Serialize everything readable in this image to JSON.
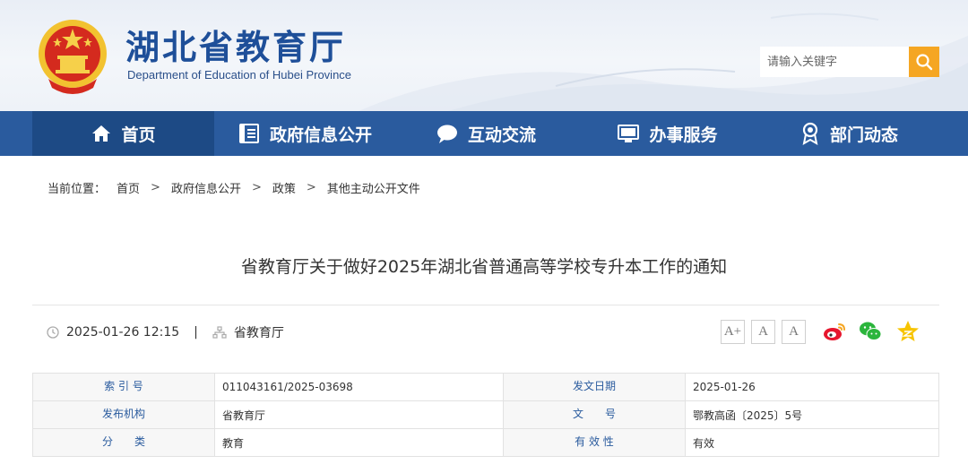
{
  "header": {
    "site_title": "湖北省教育厅",
    "site_subtitle": "Department of Education of Hubei Province",
    "search_placeholder": "请输入关键字",
    "accent_color": "#2a5b9e"
  },
  "nav": {
    "items": [
      {
        "label": "首页",
        "icon": "home-icon"
      },
      {
        "label": "政府信息公开",
        "icon": "document-icon"
      },
      {
        "label": "互动交流",
        "icon": "chat-icon"
      },
      {
        "label": "办事服务",
        "icon": "monitor-icon"
      },
      {
        "label": "部门动态",
        "icon": "badge-icon"
      }
    ]
  },
  "breadcrumb": {
    "prefix": "当前位置：",
    "items": [
      "首页",
      "政府信息公开",
      "政策",
      "其他主动公开文件"
    ],
    "separator": ">"
  },
  "article": {
    "title": "省教育厅关于做好2025年湖北省普通高等学校专升本工作的通知",
    "datetime": "2025-01-26 12:15",
    "meta_separator": "|",
    "source": "省教育厅"
  },
  "font_controls": [
    "A+",
    "A",
    "A"
  ],
  "info": {
    "rows": [
      {
        "label1": "索 引 号",
        "value1": "011043161/2025-03698",
        "label2": "发文日期",
        "value2": "2025-01-26"
      },
      {
        "label1": "发布机构",
        "value1": "省教育厅",
        "label2": "文　　号",
        "value2": "鄂教高函〔2025〕5号"
      },
      {
        "label1": "分　　类",
        "value1": "教育",
        "label2": "有 效 性",
        "value2": "有效"
      }
    ]
  }
}
